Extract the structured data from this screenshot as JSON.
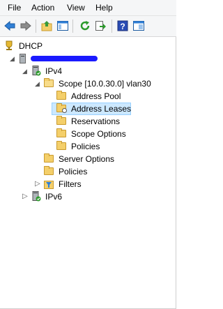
{
  "menu": {
    "file": "File",
    "action": "Action",
    "view": "View",
    "help": "Help"
  },
  "toolbar": {
    "buttons": [
      "back-icon",
      "forward-icon",
      "up-folder-icon",
      "show-hide-tree-icon",
      "refresh-icon",
      "export-list-icon",
      "help-icon",
      "properties-icon"
    ]
  },
  "tree": {
    "root": "DHCP",
    "server": "",
    "ipv4": "IPv4",
    "scope": "Scope [10.0.30.0] vlan30",
    "address_pool": "Address Pool",
    "address_leases": "Address Leases",
    "reservations": "Reservations",
    "scope_options": "Scope Options",
    "policies_scope": "Policies",
    "server_options": "Server Options",
    "policies": "Policies",
    "filters": "Filters",
    "ipv6": "IPv6"
  },
  "colors": {
    "selection_bg": "#cce8ff",
    "folder": "#f4cf6a",
    "redaction": "#1a1aff"
  }
}
